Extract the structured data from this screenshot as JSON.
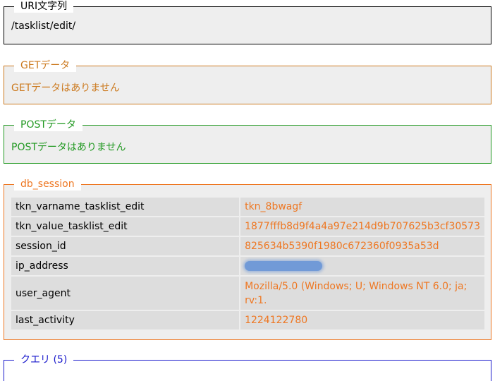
{
  "uri": {
    "legend": "URI文字列",
    "value": "/tasklist/edit/"
  },
  "get": {
    "legend": "GETデータ",
    "value": "GETデータはありません"
  },
  "post": {
    "legend": "POSTデータ",
    "value": "POSTデータはありません"
  },
  "db_session": {
    "legend": "db_session",
    "rows": [
      {
        "key": "tkn_varname_tasklist_edit",
        "value": "tkn_8bwagf"
      },
      {
        "key": "tkn_value_tasklist_edit",
        "value": "1877fffb8d9f4a4a97e214d9b707625b3cf30573"
      },
      {
        "key": "session_id",
        "value": "825634b5390f1980c672360f0935a53d"
      },
      {
        "key": "ip_address",
        "value": ""
      },
      {
        "key": "user_agent",
        "value": "Mozilla/5.0 (Windows; U; Windows NT 6.0; ja; rv:1."
      },
      {
        "key": "last_activity",
        "value": "1224122780"
      }
    ]
  },
  "query": {
    "legend": "クエリ (5)"
  },
  "colors": {
    "uri": "#000000",
    "get": "#cc7a1f",
    "post": "#229922",
    "db_session": "#ee7722",
    "query": "#1a1acc",
    "section_bg": "#eeeeee",
    "row_bg": "#dddddd"
  }
}
